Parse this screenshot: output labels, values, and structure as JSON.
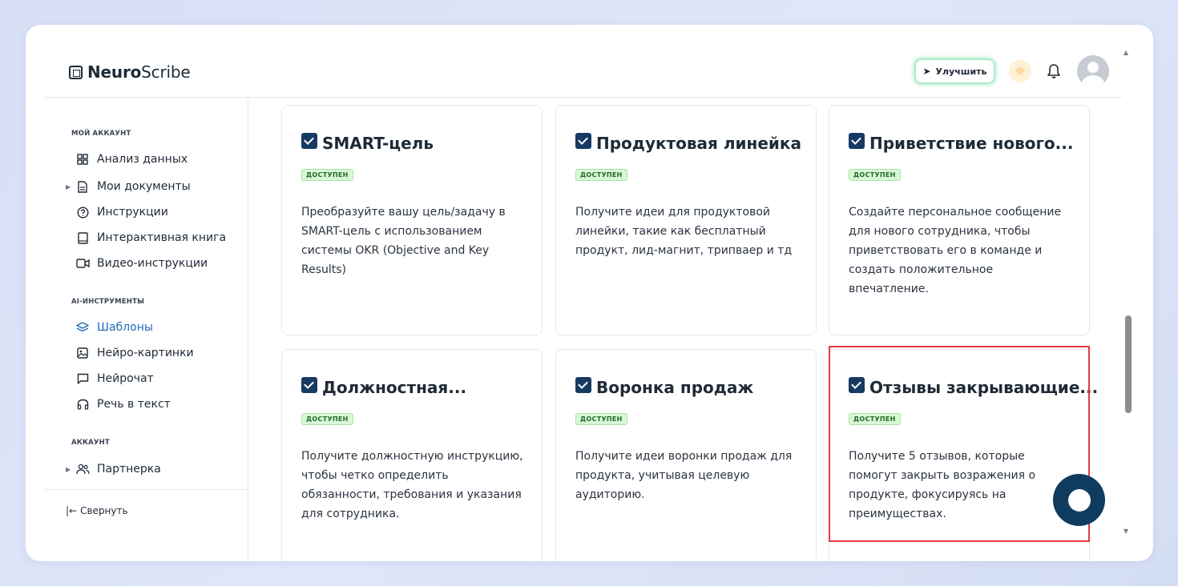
{
  "brand": {
    "bold": "Neuro",
    "light": "Scribe"
  },
  "header": {
    "upgrade_label": "Улучшить"
  },
  "sidebar": {
    "sections": [
      {
        "label": "МОЙ АККАУНТ"
      },
      {
        "label": "AI-ИНСТРУМЕНТЫ"
      },
      {
        "label": "АККАУНТ"
      }
    ],
    "items": [
      {
        "label": "Анализ данных",
        "icon": "grid-icon"
      },
      {
        "label": "Мои документы",
        "icon": "document-icon"
      },
      {
        "label": "Инструкции",
        "icon": "help-circle-icon"
      },
      {
        "label": "Интерактивная книга",
        "icon": "book-icon"
      },
      {
        "label": "Видео-инструкции",
        "icon": "video-icon"
      },
      {
        "label": "Шаблоны",
        "icon": "layers-icon",
        "active": true
      },
      {
        "label": "Нейро-картинки",
        "icon": "image-icon"
      },
      {
        "label": "Нейрочат",
        "icon": "chat-icon"
      },
      {
        "label": "Речь в текст",
        "icon": "headphones-icon"
      },
      {
        "label": "Партнерка",
        "icon": "users-icon"
      }
    ],
    "collapse_label": "Свернуть"
  },
  "cards": [
    {
      "title": "SMART-цель",
      "badge": "ДОСТУПЕН",
      "desc": "Преобразуйте вашу цель/задачу в SMART-цель с использованием системы OKR (Objective and Key Results)"
    },
    {
      "title": "Продуктовая линейка",
      "badge": "ДОСТУПЕН",
      "desc": "Получите идеи для продуктовой линейки, такие как бесплатный продукт, лид-магнит, трипваер и тд"
    },
    {
      "title": "Приветствие нового...",
      "badge": "ДОСТУПЕН",
      "desc": "Создайте персональное сообщение для нового сотрудника, чтобы приветствовать его в команде и создать положительное впечатление."
    },
    {
      "title": "Должностная...",
      "badge": "ДОСТУПЕН",
      "desc": "Получите должностную инструкцию, чтобы четко определить обязанности, требования и указания для сотрудника."
    },
    {
      "title": "Воронка продаж",
      "badge": "ДОСТУПЕН",
      "desc": "Получите идеи воронки продаж для продукта, учитывая целевую аудиторию."
    },
    {
      "title": "Отзывы закрывающие...",
      "badge": "ДОСТУПЕН",
      "desc": "Получите 5 отзывов, которые помогут закрыть возражения о продукте, фокусируясь на преимуществах."
    }
  ],
  "colors": {
    "accent": "#1d6ab8",
    "badge_bg": "#d9f7d6",
    "highlight": "#e5393f",
    "chat_fab": "#0f3b5f"
  }
}
